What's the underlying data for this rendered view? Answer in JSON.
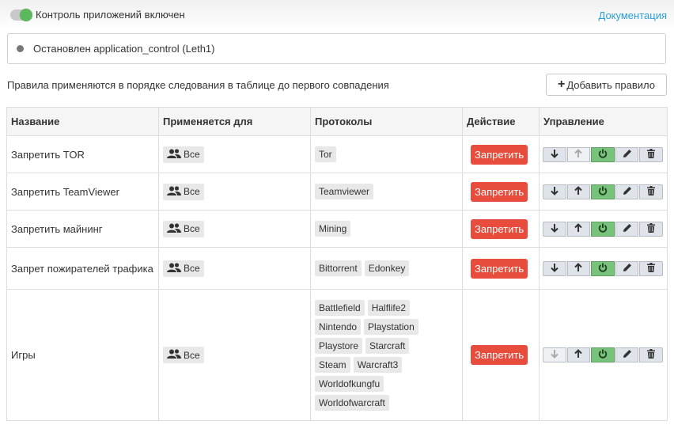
{
  "header": {
    "toggle_label": "Контроль приложений включен",
    "toggle_on": true,
    "docs_link": "Документация"
  },
  "status": {
    "text": "Остановлен application_control (Leth1)"
  },
  "hint": "Правила применяются в порядке следования в таблице до первого совпадения",
  "add_rule_label": "Добавить правило",
  "table": {
    "columns": [
      "Название",
      "Применяется для",
      "Протоколы",
      "Действие",
      "Управление"
    ],
    "rows": [
      {
        "name": "Запретить TOR",
        "applies_to": "Все",
        "protocols": [
          "Tor"
        ],
        "action": "Запретить",
        "down_enabled": true,
        "up_enabled": false
      },
      {
        "name": "Запретить TeamViewer",
        "applies_to": "Все",
        "protocols": [
          "Teamviewer"
        ],
        "action": "Запретить",
        "down_enabled": true,
        "up_enabled": true
      },
      {
        "name": "Запретить майнинг",
        "applies_to": "Все",
        "protocols": [
          "Mining"
        ],
        "action": "Запретить",
        "down_enabled": true,
        "up_enabled": true
      },
      {
        "name": "Запрет пожирателей трафика",
        "applies_to": "Все",
        "protocols": [
          "Bittorrent",
          "Edonkey"
        ],
        "action": "Запретить",
        "down_enabled": true,
        "up_enabled": true
      },
      {
        "name": "Игры",
        "applies_to": "Все",
        "protocols": [
          "Battlefield",
          "Halflife2",
          "Nintendo",
          "Playstation",
          "Playstore",
          "Starcraft",
          "Steam",
          "Warcraft3",
          "Worldofkungfu",
          "Worldofwarcraft"
        ],
        "action": "Запретить",
        "down_enabled": false,
        "up_enabled": true
      }
    ]
  },
  "icons": {
    "users": "users-icon",
    "down": "arrow-down-icon",
    "up": "arrow-up-icon",
    "power": "power-icon",
    "edit": "pencil-icon",
    "delete": "trash-icon",
    "plus": "plus-icon"
  },
  "colors": {
    "toggle_on": "#5cb85c",
    "link": "#2a9fd6",
    "deny": "#e74c3c",
    "power_button": "#78c37c"
  }
}
